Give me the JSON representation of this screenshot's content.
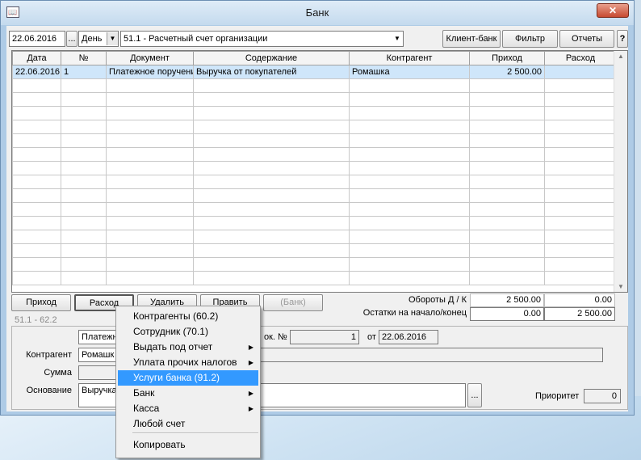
{
  "window": {
    "title": "Банк",
    "close": "✕"
  },
  "toolbar": {
    "date": "22.06.2016",
    "ellipsis": "...",
    "period": "День",
    "account": "51.1 - Расчетный счет организации",
    "client_bank": "Клиент-банк",
    "filter": "Фильтр",
    "reports": "Отчеты",
    "help": "?"
  },
  "table": {
    "columns": [
      "Дата",
      "№",
      "Документ",
      "Содержание",
      "Контрагент",
      "Приход",
      "Расход"
    ],
    "rows": [
      [
        "22.06.2016",
        "1",
        "Платежное поручение",
        "Выручка от покупателей",
        "Ромашка",
        "2 500.00",
        ""
      ]
    ]
  },
  "buttons": {
    "income": "Приход",
    "expense": "Расход",
    "delete": "Удалить",
    "edit": "Править",
    "bank": "(Банк)"
  },
  "totals": {
    "turnover_label": "Обороты Д / К",
    "turnover_debit": "2 500.00",
    "turnover_credit": "0.00",
    "balance_label": "Остатки на начало/конец",
    "balance_start": "0.00",
    "balance_end": "2 500.00"
  },
  "account_info": "51.1 - 62.2",
  "details": {
    "doc_type": "Платежн",
    "doc_num_label": "ок. №",
    "doc_num": "1",
    "from_label": "от",
    "doc_date": "22.06.2016",
    "counterparty_label": "Контрагент",
    "counterparty": "Ромашк",
    "sum_label": "Сумма",
    "basis_label": "Основание",
    "basis": "Выручка",
    "basis_btn": "...",
    "priority_label": "Приоритет",
    "priority": "0"
  },
  "context_menu": [
    {
      "label": "Контрагенты (60.2)",
      "submenu": false
    },
    {
      "label": "Сотрудник (70.1)",
      "submenu": false
    },
    {
      "label": "Выдать под отчет",
      "submenu": true
    },
    {
      "label": "Уплата прочих налогов",
      "submenu": true
    },
    {
      "label": "Услуги банка (91.2)",
      "submenu": false,
      "selected": true
    },
    {
      "label": "Банк",
      "submenu": true
    },
    {
      "label": "Касса",
      "submenu": true
    },
    {
      "label": "Любой счет",
      "submenu": false
    },
    {
      "label": "Копировать",
      "submenu": false
    }
  ],
  "icons": {
    "submenu_arrow": "▶",
    "dropdown_arrow": "▼",
    "scroll_up": "▲",
    "scroll_down": "▼"
  }
}
